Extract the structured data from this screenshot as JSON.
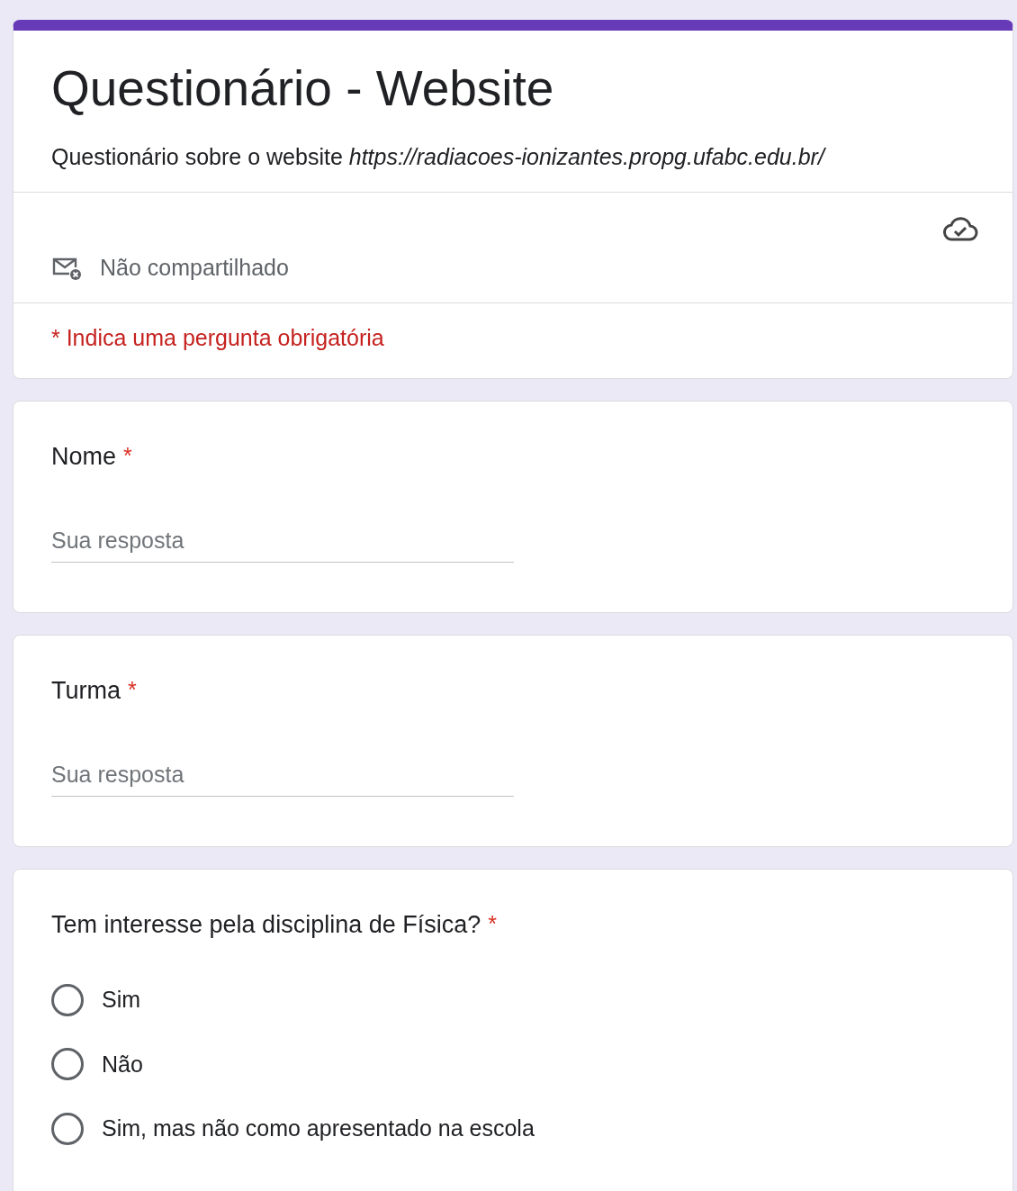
{
  "header": {
    "title": "Questionário - Website",
    "description": "Questionário sobre o website *https://radiacoes-ionizantes.propg.ufabc.edu.br/*",
    "sharing_status": "Não compartilhado",
    "required_note": "* Indica uma pergunta obrigatória"
  },
  "questions": [
    {
      "kind": "text",
      "title": "Nome",
      "required_mark": "*",
      "placeholder": "Sua resposta"
    },
    {
      "kind": "text",
      "title": "Turma",
      "required_mark": "*",
      "placeholder": "Sua resposta"
    },
    {
      "kind": "radio",
      "title": "Tem interesse pela disciplina de Física?",
      "required_mark": "*",
      "options": [
        {
          "label": "Sim",
          "selected": false
        },
        {
          "label": "Não",
          "selected": false
        },
        {
          "label": "Sim, mas não como apresentado na escola",
          "selected": false
        }
      ]
    }
  ]
}
